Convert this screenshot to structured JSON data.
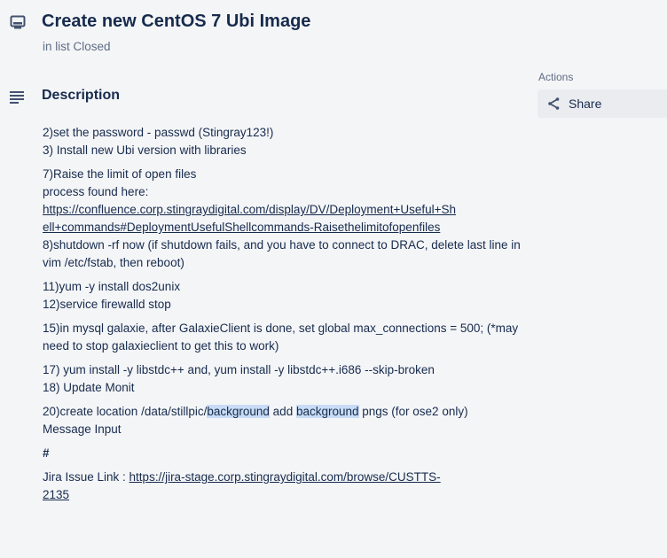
{
  "card": {
    "title": "Create new CentOS 7 Ubi Image",
    "in_list": "in list Closed"
  },
  "description": {
    "heading": "Description",
    "lines": {
      "p1a": "2)set the password - passwd (Stingray123!)",
      "p1b": "3) Install new Ubi version with libraries",
      "p2a": "7)Raise the limit of open files",
      "p2b": "process found here:",
      "p2link_a": "https://confluence.corp.stingraydigital.com/display/DV/Deployment+Useful+Sh",
      "p2link_b": "ell+commands#DeploymentUsefulShellcommands-Raisethelimitofopenfiles",
      "p2c": "8)shutdown -rf now (if shutdown fails, and you have to connect to DRAC, delete last line in vim /etc/fstab, then reboot)",
      "p3a": "11)yum -y install dos2unix",
      "p3b": "12)service firewalld stop",
      "p4": "15)in mysql galaxie, after GalaxieClient is done, set global max_connections = 500; (*may need to stop galaxieclient to get this to work)",
      "p5a": "17) yum install -y libstdc++ and, yum install -y libstdc++.i686 --skip-broken",
      "p5b": "18) Update Monit",
      "p6_pre": "20)create location /data/stillpic/",
      "p6_hl1": "background",
      "p6_mid": " add ",
      "p6_hl2": "background",
      "p6_post": " pngs (for ose2 only)",
      "p6b": "Message Input",
      "hash": "#",
      "jira_label": "Jira Issue Link : ",
      "jira_link_a": "https://jira-stage.corp.stingraydigital.com/browse/CUSTTS-",
      "jira_link_b": "2135"
    }
  },
  "sidebar": {
    "actions_label": "Actions",
    "share_label": "Share"
  },
  "icons": {
    "card": "card-icon",
    "description": "description-lines-icon",
    "share": "share-icon"
  }
}
